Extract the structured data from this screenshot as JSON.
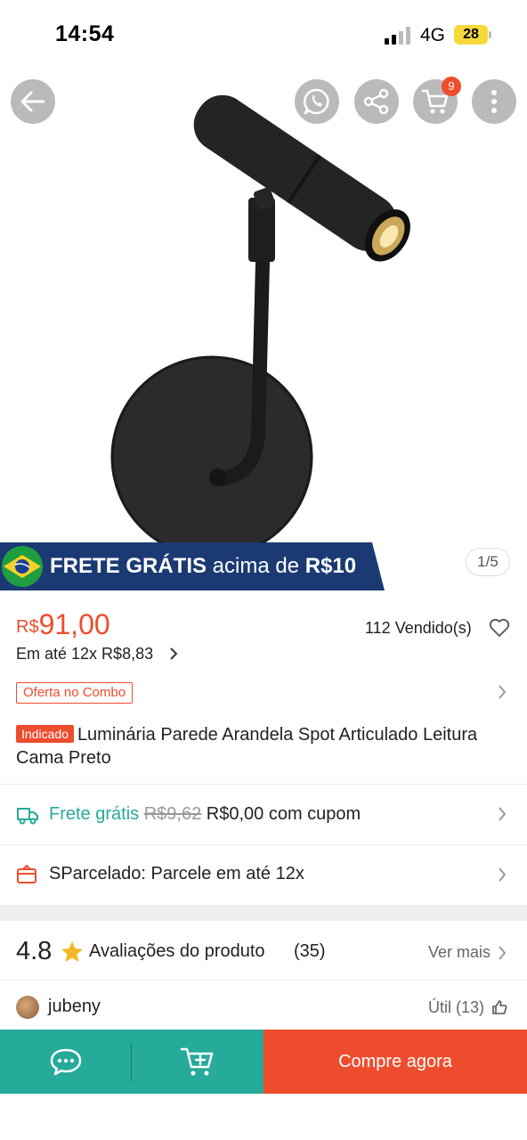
{
  "status_bar": {
    "time": "14:54",
    "network": "4G",
    "battery": "28"
  },
  "header": {
    "cart_count": "9"
  },
  "banner": {
    "frete_bold": "FRETE GRÁTIS",
    "frete_mid": " acima de ",
    "frete_amount": "R$10",
    "image_counter": "1/5"
  },
  "product": {
    "price_currency": "R$",
    "price_value": "91,00",
    "sold": "112 Vendido(s)",
    "installments_prefix": "Em até ",
    "installments_value": "12x R$8,83",
    "combo_tag": "Oferta no Combo",
    "badge": "Indicado",
    "title": "Luminária Parede Arandela Spot Articulado Leitura Cama Preto"
  },
  "shipping": {
    "label": "Frete grátis",
    "old_price": "R$9,62",
    "new_price": "R$0,00 com cupom"
  },
  "installment_row": {
    "text": "SParcelado: Parcele em até 12x"
  },
  "reviews": {
    "rating": "4.8",
    "label": "Avaliações do produto",
    "count": "(35)",
    "see_more": "Ver mais",
    "first_user": "jubeny",
    "helpful": "Útil (13)"
  },
  "bottom_bar": {
    "buy_label": "Compre agora"
  },
  "colors": {
    "accent": "#ee4d2d",
    "teal": "#26aa99",
    "banner_navy": "#1b3a73"
  },
  "icons": [
    "back-arrow-icon",
    "whatsapp-icon",
    "share-icon",
    "cart-icon",
    "more-icon",
    "brazil-flag-icon",
    "heart-icon",
    "truck-icon",
    "card-icon",
    "star-icon",
    "thumbs-up-icon",
    "chat-icon",
    "add-to-cart-icon"
  ]
}
